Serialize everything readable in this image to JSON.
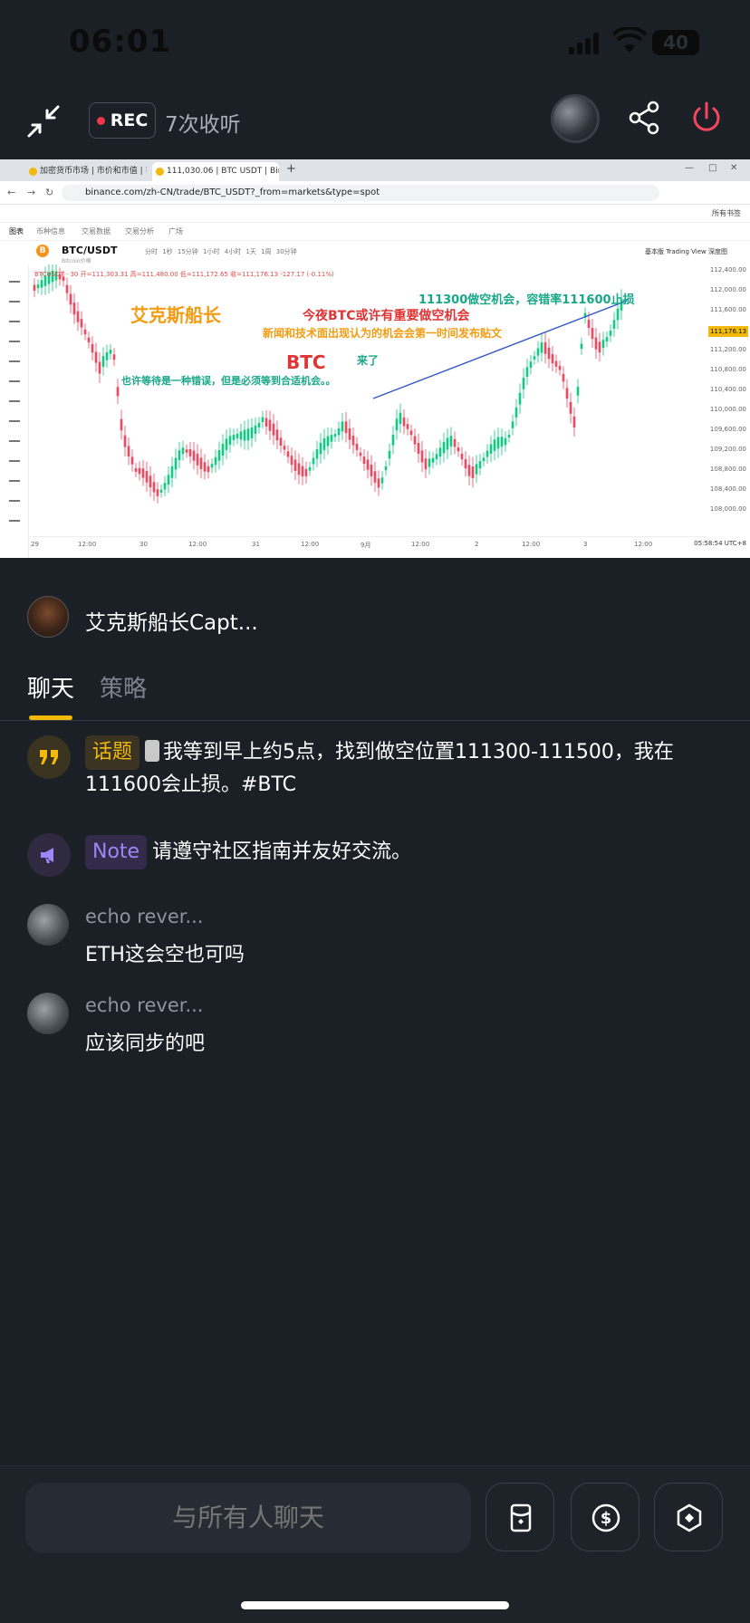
{
  "status_bar": {
    "time": "06:01",
    "battery": "40"
  },
  "header": {
    "rec_label": "REC",
    "listens": "7次收听",
    "icons": [
      "collapse-icon",
      "share-icon",
      "power-icon"
    ]
  },
  "screen_share": {
    "tabs": [
      "加密货币市场 | 市价和市值 | 币...",
      "111,030.06 | BTC USDT | Bina..."
    ],
    "url": "binance.com/zh-CN/trade/BTC_USDT?_from=markets&type=spot",
    "bookmarks_folder": "所有书签",
    "subnav": [
      "图表",
      "币种信息",
      "交易数据",
      "交易分析",
      "广场"
    ],
    "pair": "BTC/USDT",
    "pair_sub": "Bitcoin价格",
    "intervals": "分时 1秒 15分钟 1小时 4小时 1天 1周 30分钟",
    "view_label": "基本版  Trading View  深度图",
    "ohlc": "BTCUSDT · 30  开=111,303.31  高=111,480.00  低=111,172.65  收=111,176.13  -127.17 (-0.11%)",
    "price_labels": [
      "112,400.00",
      "112,000.00",
      "111,600.00",
      "111,200.00",
      "110,800.00",
      "110,400.00",
      "110,000.00",
      "109,600.00",
      "109,200.00",
      "108,800.00",
      "108,400.00",
      "108,000.00"
    ],
    "current_price": "111,176.13",
    "time_labels": [
      "29",
      "12:00",
      "30",
      "12:00",
      "31",
      "12:00",
      "9月",
      "12:00",
      "2",
      "12:00",
      "3",
      "12:00"
    ],
    "clock": "05:58:54 UTC+8",
    "annotations": {
      "captain": "艾克斯船长",
      "short": "111300做空机会，容错率111600止损",
      "tonight": "今夜BTC或许有重要做空机会",
      "news": "新闻和技术面出现认为的机会会第一时间发布贴文",
      "btc": "BTC",
      "come": "来了",
      "wait": "也许等待是一种错误，但是必须等到合适机会。。"
    }
  },
  "host": {
    "name": "艾克斯船长Capt..."
  },
  "tabs": {
    "chat": "聊天",
    "strategy": "策略"
  },
  "messages": [
    {
      "type": "topic",
      "badge": "话题",
      "text": "我等到早上约5点，找到做空位置111300-111500，我在111600会止损。#BTC"
    },
    {
      "type": "note",
      "badge": "Note",
      "text": "请遵守社区指南并友好交流。"
    },
    {
      "type": "user",
      "name": "echo rever...",
      "text": "ETH这会空也可吗"
    },
    {
      "type": "user",
      "name": "echo rever...",
      "text": "应该同步的吧"
    }
  ],
  "composer": {
    "placeholder": "与所有人聊天",
    "buttons": [
      "red-packet-icon",
      "dollar-icon",
      "binance-icon"
    ]
  },
  "colors": {
    "accent": "#f0b90b",
    "rec": "#f0364f",
    "power": "#f6465d",
    "background": "#1b1f26"
  }
}
